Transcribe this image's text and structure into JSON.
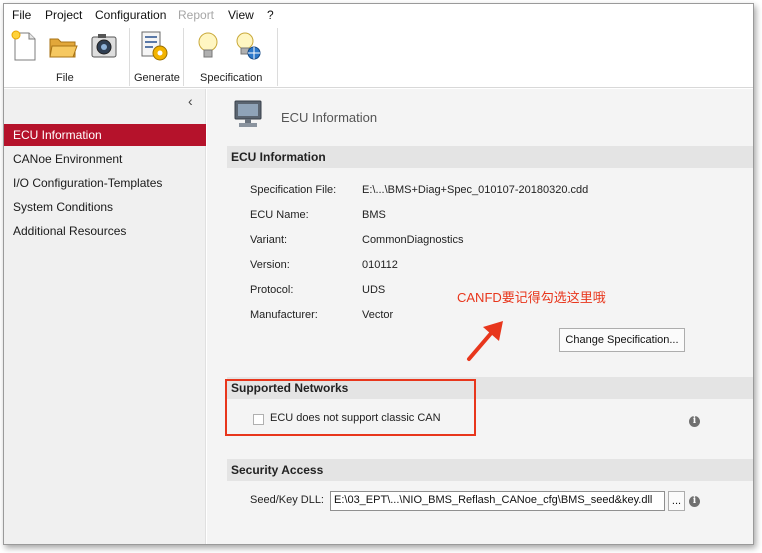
{
  "menu": {
    "file": "File",
    "project": "Project",
    "configuration": "Configuration",
    "report": "Report",
    "view": "View",
    "help": "?"
  },
  "ribbon": {
    "groups": {
      "file": "File",
      "generate": "Generate",
      "specification": "Specification"
    }
  },
  "sidebar": {
    "items": [
      {
        "label": "ECU Information"
      },
      {
        "label": "CANoe Environment"
      },
      {
        "label": "I/O Configuration-Templates"
      },
      {
        "label": "System Conditions"
      },
      {
        "label": "Additional Resources"
      }
    ]
  },
  "main": {
    "title": "ECU Information",
    "ecu_section": {
      "heading": "ECU Information",
      "rows": [
        {
          "label": "Specification File:",
          "value": "E:\\...\\BMS+Diag+Spec_010107-20180320.cdd"
        },
        {
          "label": "ECU Name:",
          "value": "BMS"
        },
        {
          "label": "Variant:",
          "value": "CommonDiagnostics"
        },
        {
          "label": "Version:",
          "value": "010112"
        },
        {
          "label": "Protocol:",
          "value": "UDS"
        },
        {
          "label": "Manufacturer:",
          "value": "Vector"
        }
      ],
      "change_button": "Change Specification..."
    },
    "networks_section": {
      "heading": "Supported Networks",
      "checkbox_label": "ECU does not support classic CAN",
      "checked": false
    },
    "security_section": {
      "heading": "Security Access",
      "seed_label": "Seed/Key DLL:",
      "seed_value": "E:\\03_EPT\\...\\NIO_BMS_Reflash_CANoe_cfg\\BMS_seed&key.dll",
      "browse_label": "..."
    }
  },
  "annotation": {
    "text": "CANFD要记得勾选这里哦",
    "color": "#e8361c"
  },
  "colors": {
    "accent": "#b5122b",
    "annotation": "#e8361c"
  }
}
